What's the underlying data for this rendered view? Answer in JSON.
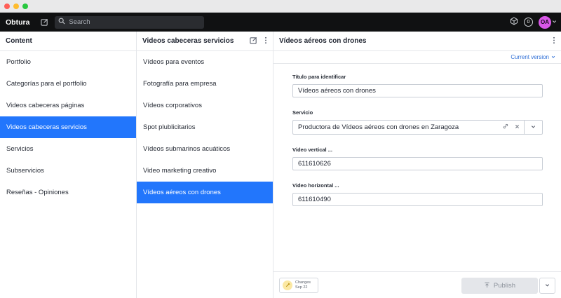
{
  "app": {
    "brand": "Obtura",
    "search_placeholder": "Search",
    "notifications_count": "0",
    "avatar_initials": "OA"
  },
  "pane_content": {
    "title": "Content",
    "items": [
      {
        "label": "Portfolio"
      },
      {
        "label": "Categorías para el portfolio"
      },
      {
        "label": "Videos cabeceras páginas"
      },
      {
        "label": "Videos cabeceras servicios",
        "selected": true
      },
      {
        "label": "Servicios"
      },
      {
        "label": "Subservicios"
      },
      {
        "label": "Reseñas - Opiniones"
      }
    ]
  },
  "pane_list": {
    "title": "Videos cabeceras servicios",
    "items": [
      {
        "label": "Vídeos para eventos"
      },
      {
        "label": "Fotografía para empresa"
      },
      {
        "label": "Vídeos corporativos"
      },
      {
        "label": "Spot plublicitarios"
      },
      {
        "label": "Vídeos submarinos acuáticos"
      },
      {
        "label": "Video marketing creativo"
      },
      {
        "label": "Vídeos aéreos con drones",
        "selected": true
      }
    ]
  },
  "document": {
    "title": "Vídeos aéreos con drones",
    "version_label": "Current version",
    "fields": {
      "title_label": "Título para identificar",
      "title_value": "Vídeos aéreos con drones",
      "service_label": "Servicio",
      "service_value": "Productora de Vídeos aéreos con drones en Zaragoza",
      "vertical_label": "Video vertical ...",
      "vertical_value": "611610626",
      "horizontal_label": "Video horizontal ...",
      "horizontal_value": "611610490"
    },
    "footer": {
      "changes_label": "Changes",
      "changes_date": "Sep 22",
      "publish_label": "Publish"
    }
  },
  "colors": {
    "accent": "#2276fc",
    "topbar": "#101112",
    "avatar": "#d957e8"
  }
}
